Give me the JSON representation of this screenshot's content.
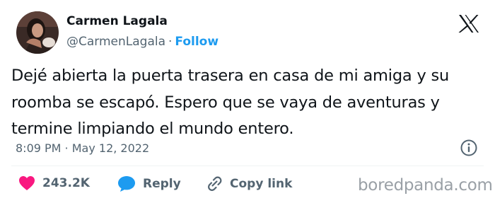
{
  "author": {
    "name": "Carmen Lagala",
    "handle": "@CarmenLagala",
    "separator": "·",
    "follow_label": "Follow"
  },
  "tweet": {
    "text": "Dejé abierta la puerta trasera en casa de mi amiga y su\nroomba se escapó. Espero que se vaya de aventuras y\ntermine limpiando el mundo entero.",
    "timestamp": "8:09 PM · May 12, 2022"
  },
  "actions": {
    "like_count": "243.2K",
    "reply_label": "Reply",
    "copy_link_label": "Copy link"
  },
  "watermark": "boredpanda.com",
  "icons": {
    "platform": "x-logo-icon",
    "info": "info-icon",
    "like": "heart-icon",
    "reply": "speech-bubble-icon",
    "copy": "link-icon"
  },
  "colors": {
    "accent": "#1d9bf0",
    "like": "#f91880",
    "secondary_text": "#536471"
  }
}
